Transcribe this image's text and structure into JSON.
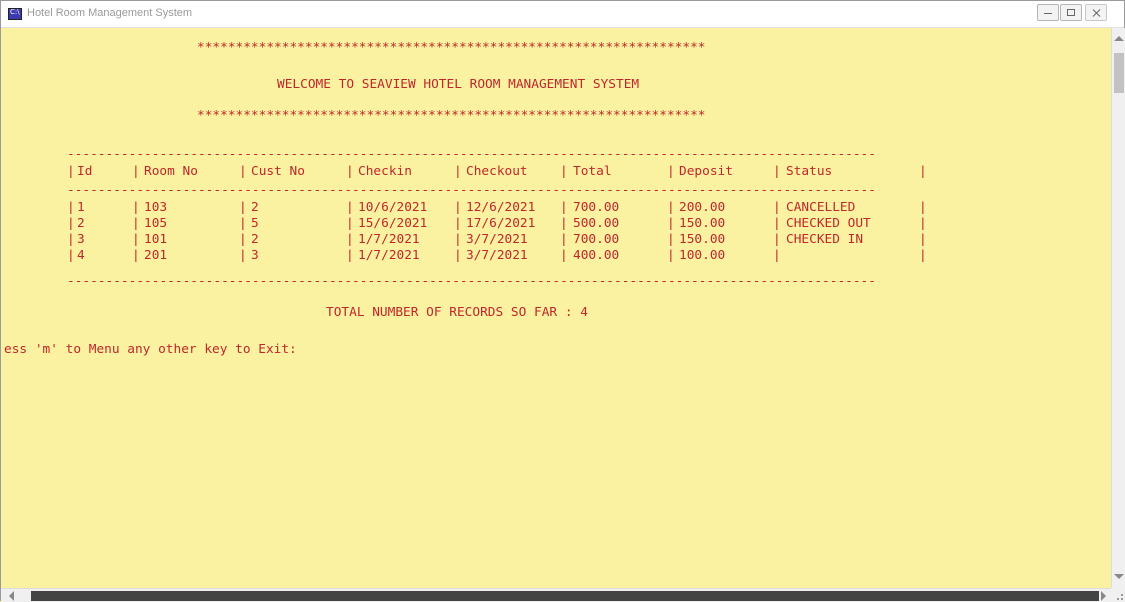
{
  "window": {
    "title": "Hotel Room Management System"
  },
  "console": {
    "stars_line": "******************************************************************",
    "welcome": "WELCOME TO SEAVIEW HOTEL ROOM MANAGEMENT SYSTEM",
    "dashes": "---------------------------------------------------------------------------------------------------------",
    "table": {
      "headers": [
        "Id",
        "Room No",
        "Cust No",
        "Checkin",
        "Checkout",
        "Total",
        "Deposit",
        "Status"
      ],
      "rows": [
        [
          "1",
          "103",
          "2",
          "10/6/2021",
          "12/6/2021",
          "700.00",
          "200.00",
          "CANCELLED"
        ],
        [
          "2",
          "105",
          "5",
          "15/6/2021",
          "17/6/2021",
          "500.00",
          "150.00",
          "CHECKED OUT"
        ],
        [
          "3",
          "101",
          "2",
          "1/7/2021",
          "3/7/2021",
          "700.00",
          "150.00",
          "CHECKED IN"
        ],
        [
          "4",
          "201",
          "3",
          "1/7/2021",
          "3/7/2021",
          "400.00",
          "100.00",
          ""
        ]
      ]
    },
    "total_records": "TOTAL NUMBER OF RECORDS SO FAR : 4",
    "prompt": "ess 'm' to Menu any other key to Exit:"
  },
  "colors": {
    "background": "#faf2a0",
    "text": "#c0272d"
  },
  "icons": {
    "app": "console-app-icon",
    "minimize": "minimize-icon",
    "maximize": "maximize-icon",
    "close": "close-icon"
  }
}
